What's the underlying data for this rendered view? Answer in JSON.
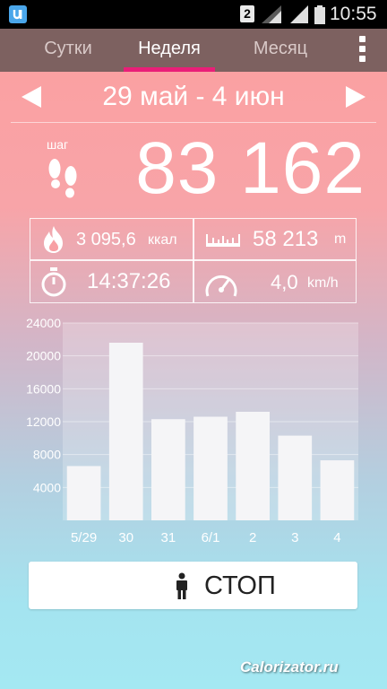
{
  "status_bar": {
    "sim_label": "2",
    "time": "10:55"
  },
  "tabs": [
    {
      "label": "Сутки",
      "active": false
    },
    {
      "label": "Неделя",
      "active": true
    },
    {
      "label": "Месяц",
      "active": false
    }
  ],
  "date_nav": {
    "range": "29 май - 4 июн"
  },
  "steps": {
    "label": "шаг",
    "value": "83 162"
  },
  "stats": {
    "calories": {
      "value": "3 095,6",
      "unit": "ккал",
      "icon": "flame-icon"
    },
    "distance": {
      "value": "58 213",
      "unit": "m",
      "icon": "ruler-icon"
    },
    "time": {
      "value": "14:37:26",
      "icon": "stopwatch-icon"
    },
    "speed": {
      "value": "4,0",
      "unit": "km/h",
      "icon": "speedometer-icon"
    }
  },
  "chart_data": {
    "type": "bar",
    "categories": [
      "5/29",
      "30",
      "31",
      "6/1",
      "2",
      "3",
      "4"
    ],
    "values": [
      6600,
      21600,
      12300,
      12600,
      13200,
      10300,
      7300
    ],
    "ylim": [
      0,
      24000
    ],
    "yticks": [
      4000,
      8000,
      12000,
      16000,
      20000,
      24000
    ],
    "grid": true,
    "bar_color": "#f5f5f7"
  },
  "stop_button": {
    "label": "СТОП",
    "icon": "person-icon"
  },
  "watermark": "Calorizator.ru",
  "colors": {
    "tab_bar": "#7d6160",
    "tab_indicator": "#e91e78",
    "gradient_top": "#fc9f9f",
    "gradient_bottom": "#a4e8f2"
  }
}
